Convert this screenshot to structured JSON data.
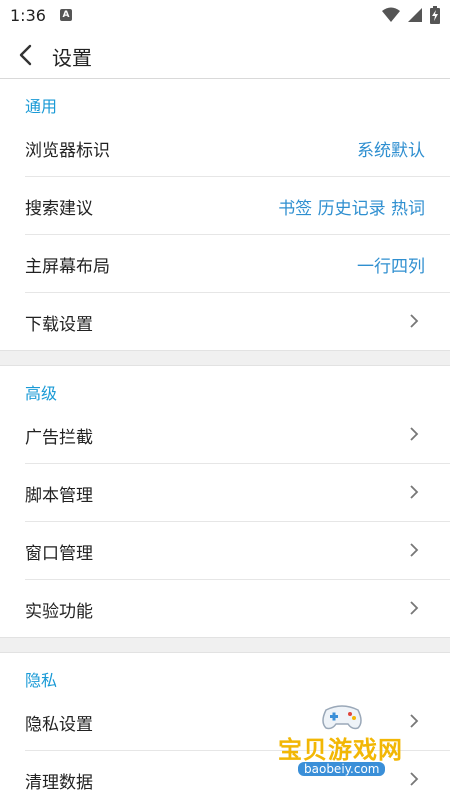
{
  "status_bar": {
    "time": "1:36",
    "notif_letter": "A"
  },
  "header": {
    "title": "设置"
  },
  "sections": [
    {
      "title": "通用",
      "rows": [
        {
          "label": "浏览器标识",
          "value": "系统默认"
        },
        {
          "label": "搜索建议",
          "value": "书签 历史记录 热词"
        },
        {
          "label": "主屏幕布局",
          "value": "一行四列"
        },
        {
          "label": "下载设置",
          "value": ""
        }
      ]
    },
    {
      "title": "高级",
      "rows": [
        {
          "label": "广告拦截"
        },
        {
          "label": "脚本管理"
        },
        {
          "label": "窗口管理"
        },
        {
          "label": "实验功能"
        }
      ]
    },
    {
      "title": "隐私",
      "rows": [
        {
          "label": "隐私设置"
        },
        {
          "label": "清理数据"
        }
      ]
    }
  ],
  "watermark": {
    "text": "宝贝游戏网",
    "url": "baobeiy.com"
  },
  "colors": {
    "accent": "#1a9ad6",
    "value_text": "#2f8fd0",
    "divider": "#e6e6e6"
  }
}
